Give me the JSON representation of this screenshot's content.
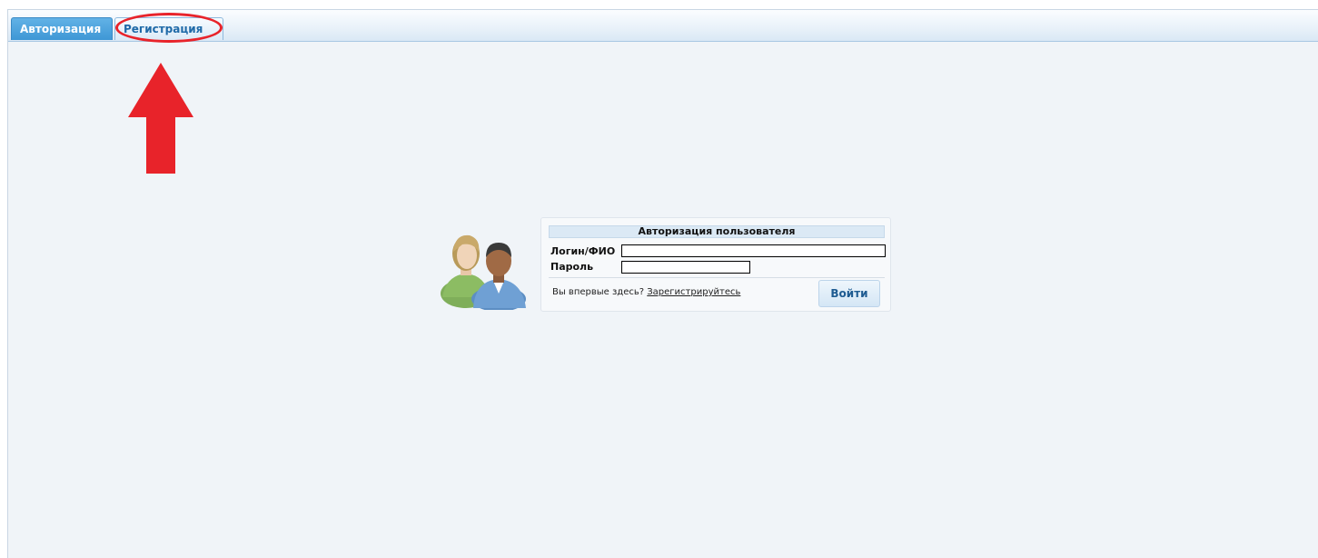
{
  "tabs": [
    {
      "label": "Авторизация",
      "active": true
    },
    {
      "label": "Регистрация",
      "active": false
    }
  ],
  "annotations": {
    "highlight_color": "#e8232a",
    "arrow_icon": "arrow-up-icon",
    "ellipse_target": "tab-registration"
  },
  "login_form": {
    "title": "Авторизация пользователя",
    "login_label": "Логин/ФИО",
    "login_value": "",
    "password_label": "Пароль",
    "password_value": "",
    "first_time_text": "Вы впервые здесь?",
    "register_link": "Зарегистрируйтесь",
    "submit_label": "Войти",
    "icon": "users-icon"
  },
  "colors": {
    "accent": "#3e97d5",
    "tab_text": "#1f6aa8",
    "background": "#f0f4f8"
  }
}
